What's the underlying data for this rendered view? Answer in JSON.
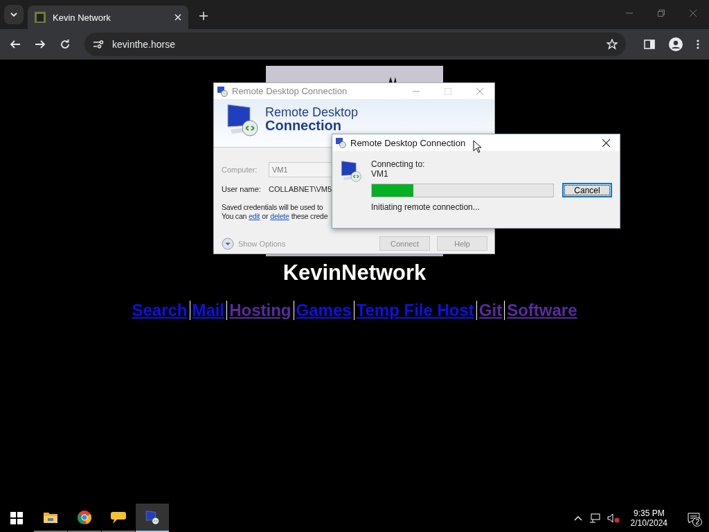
{
  "browser": {
    "tab": {
      "title": "Kevin Network",
      "selected": true
    },
    "address": "kevinthe.horse"
  },
  "page": {
    "heading": "KevinNetwork",
    "links": [
      {
        "label": "Search",
        "visited": false
      },
      {
        "label": "Mail",
        "visited": false
      },
      {
        "label": "Hosting",
        "visited": true
      },
      {
        "label": "Games",
        "visited": false
      },
      {
        "label": "Temp File Host",
        "visited": false
      },
      {
        "label": "Git",
        "visited": true
      },
      {
        "label": "Software",
        "visited": true
      }
    ]
  },
  "rdc_window": {
    "title": "Remote Desktop Connection",
    "banner_line_1": "Remote Desktop",
    "banner_line_2": "Connection",
    "computer": {
      "label": "Computer:",
      "value": "VM1",
      "disabled": true
    },
    "user": {
      "label": "User name:",
      "value": "COLLABNET\\VM5"
    },
    "note_1": "Saved credentials will be used to",
    "note_2_start": "You can",
    "link_edit": "edit",
    "note_2_mid": "or",
    "link_delete": "delete",
    "note_2_end": "these crede",
    "show_options": {
      "label": "Show Options",
      "disabled": true
    },
    "buttons": [
      {
        "label": "Connect",
        "disabled": true
      },
      {
        "label": "Help",
        "disabled": true
      }
    ]
  },
  "progress_dialog": {
    "title": "Remote Desktop Connection",
    "connecting_label": "Connecting to:",
    "target": "VM1",
    "progress": {
      "level": 0.23
    },
    "status": "Initiating remote connection...",
    "cancel": {
      "label": "Cancel",
      "focused": true
    }
  },
  "taskbar": {
    "apps": [
      {
        "kind": "explorer",
        "running": true,
        "selected": false
      },
      {
        "kind": "chrome",
        "running": true,
        "selected": false
      },
      {
        "kind": "chat",
        "running": true,
        "selected": false
      },
      {
        "kind": "rdc",
        "running": true,
        "selected": true
      }
    ],
    "time": "9:35 PM",
    "date": "2/10/2024",
    "notifications": "2"
  }
}
